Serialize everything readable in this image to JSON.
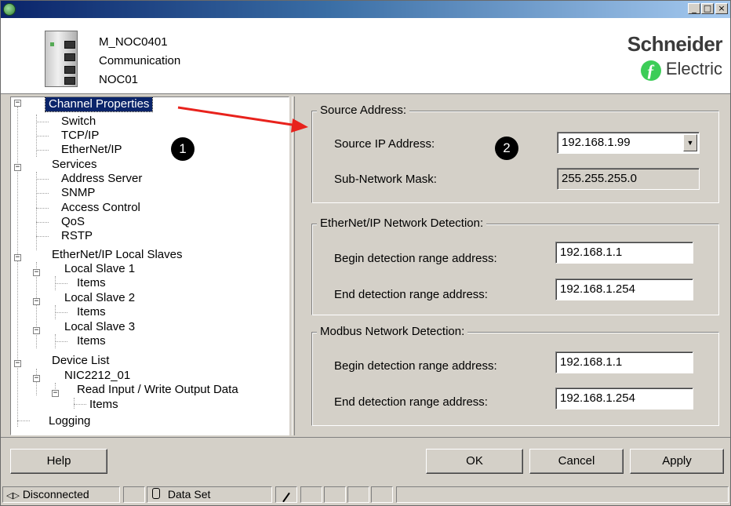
{
  "window": {
    "minimize": "_",
    "maximize": "□",
    "close": "×"
  },
  "header": {
    "module_name": "M_NOC0401",
    "module_type": "Communication",
    "module_id": "NOC01",
    "logo_line1": "Schneider",
    "logo_line2": "Electric"
  },
  "tree": [
    {
      "label": "Channel Properties",
      "selected": true
    },
    {
      "label": "Switch"
    },
    {
      "label": "TCP/IP"
    },
    {
      "label": "EtherNet/IP"
    },
    {
      "label": "Services"
    },
    {
      "label": "Address Server"
    },
    {
      "label": "SNMP"
    },
    {
      "label": "Access Control"
    },
    {
      "label": "QoS"
    },
    {
      "label": "RSTP"
    },
    {
      "label": "EtherNet/IP Local Slaves"
    },
    {
      "label": "Local Slave 1"
    },
    {
      "label": "Items"
    },
    {
      "label": "Local Slave 2"
    },
    {
      "label": "Items"
    },
    {
      "label": "Local Slave 3"
    },
    {
      "label": "Items"
    },
    {
      "label": "Device List"
    },
    {
      "label": "NIC2212_01"
    },
    {
      "label": "Read Input / Write Output Data"
    },
    {
      "label": "Items"
    },
    {
      "label": "Logging"
    }
  ],
  "annotations": {
    "badge1": "1",
    "badge2": "2",
    "arrow_color": "#e8221c"
  },
  "source": {
    "legend": "Source Address:",
    "ip_label": "Source IP Address:",
    "ip_value": "192.168.1.99",
    "mask_label": "Sub-Network Mask:",
    "mask_value": "255.255.255.0"
  },
  "ethernet_ip": {
    "legend": "EtherNet/IP Network Detection:",
    "begin_label": "Begin detection range address:",
    "begin_value": "192.168.1.1",
    "end_label": "End detection range address:",
    "end_value": "192.168.1.254"
  },
  "modbus": {
    "legend": "Modbus Network Detection:",
    "begin_label": "Begin detection range address:",
    "begin_value": "192.168.1.1",
    "end_label": "End detection range address:",
    "end_value": "192.168.1.254"
  },
  "buttons": {
    "help": "Help",
    "ok": "OK",
    "cancel": "Cancel",
    "apply": "Apply"
  },
  "status": {
    "connection": "Disconnected",
    "dataset": "Data Set"
  }
}
